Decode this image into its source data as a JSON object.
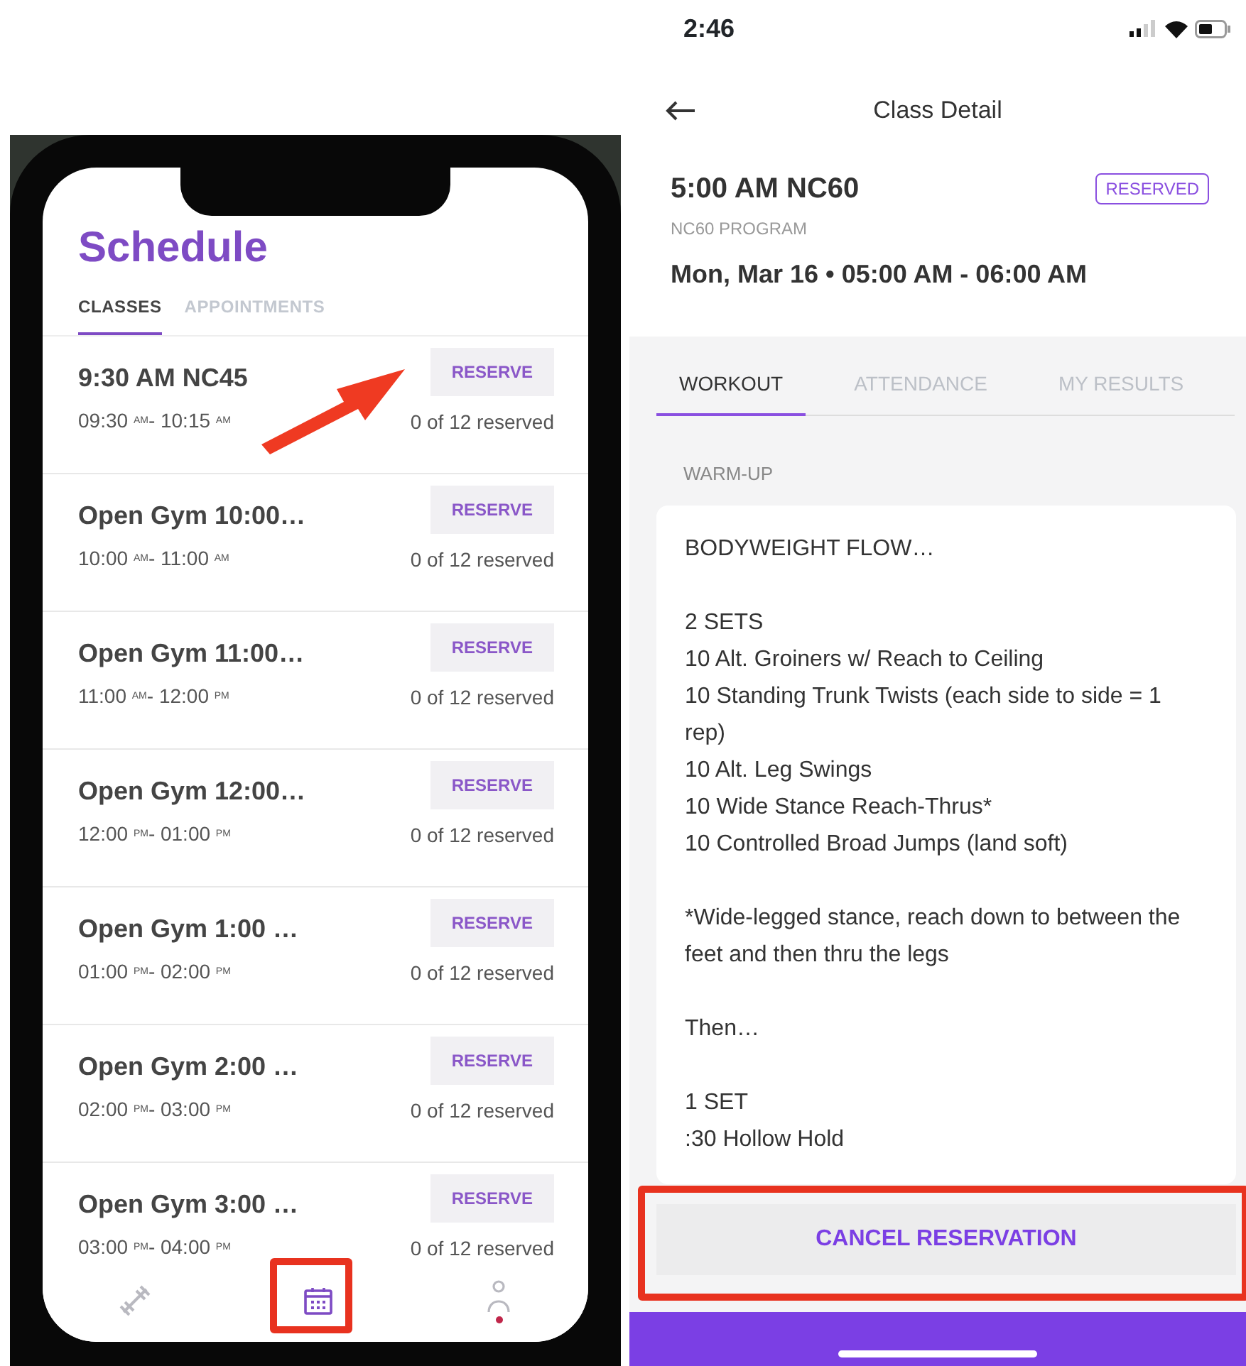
{
  "schedule_phone": {
    "title": "Schedule",
    "tabs": [
      {
        "label": "CLASSES",
        "selected": true
      },
      {
        "label": "APPOINTMENTS",
        "selected": false
      }
    ],
    "classes": [
      {
        "name": "9:30 AM NC45",
        "time": "09:30 $^{AM}$- 10:15 $^{AM}$",
        "button": "RESERVE",
        "capacity": "0 of 12 reserved"
      },
      {
        "name": "Open Gym 10:00…",
        "time": "10:00 $^{AM}$- 11:00 $^{AM}$",
        "button": "RESERVE",
        "capacity": "0 of 12 reserved"
      },
      {
        "name": "Open Gym 11:00…",
        "time": "11:00 $^{AM}$- 12:00 $^{PM}$",
        "button": "RESERVE",
        "capacity": "0 of 12 reserved"
      },
      {
        "name": "Open Gym 12:00…",
        "time": "12:00 $^{PM}$- 01:00 $^{PM}$",
        "button": "RESERVE",
        "capacity": "0 of 12 reserved"
      },
      {
        "name": "Open Gym 1:00 …",
        "time": "01:00 $^{PM}$- 02:00 $^{PM}$",
        "button": "RESERVE",
        "capacity": "0 of 12 reserved"
      },
      {
        "name": "Open Gym 2:00 …",
        "time": "02:00 $^{PM}$- 03:00 $^{PM}$",
        "button": "RESERVE",
        "capacity": "0 of 12 reserved"
      },
      {
        "name": "Open Gym 3:00 …",
        "time": "03:00 $^{PM}$- 04:00 $^{PM}$",
        "button": "RESERVE",
        "capacity": "0 of 12 reserved"
      }
    ],
    "nav": [
      {
        "kind": "workout",
        "selected": false,
        "notification": false
      },
      {
        "kind": "schedule",
        "selected": true,
        "notification": false
      },
      {
        "kind": "profile",
        "selected": false,
        "notification": true
      }
    ]
  },
  "class_detail": {
    "status_bar": {
      "time": "2:46"
    },
    "header": {
      "title": "Class Detail"
    },
    "class": {
      "name": "5:00 AM NC60",
      "status": "RESERVED",
      "program": "NC60 PROGRAM",
      "when": "Mon, Mar 16 • 05:00 AM - 06:00 AM"
    },
    "tabs": [
      {
        "label": "WORKOUT",
        "selected": true
      },
      {
        "label": "ATTENDANCE",
        "selected": false
      },
      {
        "label": "MY RESULTS",
        "selected": false
      }
    ],
    "section": "WARM-UP",
    "workout": [
      [
        "BODYWEIGHT FLOW…"
      ],
      [
        "2 SETS",
        "10 Alt. Groiners w/ Reach to Ceiling",
        "10 Standing Trunk Twists (each side to side = 1 rep)",
        "10 Alt. Leg Swings",
        "10 Wide Stance Reach-Thrus*",
        "10 Controlled Broad Jumps (land soft)"
      ],
      [
        "*Wide-legged stance, reach down to between the feet and then thru the legs"
      ],
      [
        "Then…"
      ],
      [
        "1 SET",
        ":30 Hollow Hold"
      ]
    ],
    "action": "CANCEL RESERVATION"
  }
}
